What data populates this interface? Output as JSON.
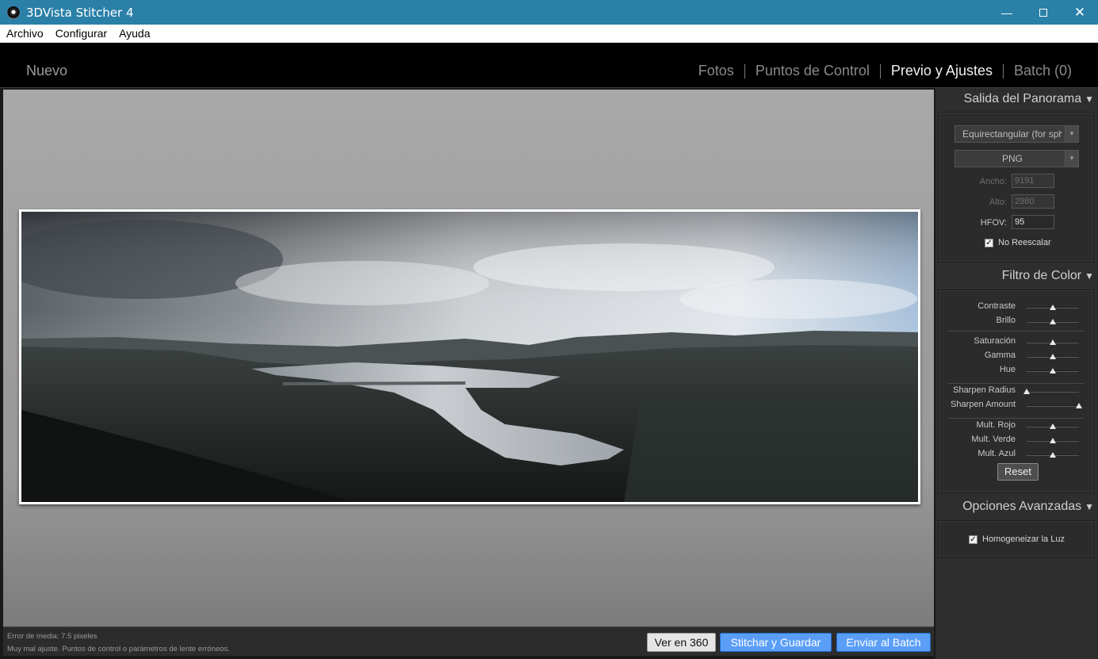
{
  "window": {
    "title": "3DVista Stitcher 4"
  },
  "menu": [
    "Archivo",
    "Configurar",
    "Ayuda"
  ],
  "nav": {
    "new_label": "Nuevo",
    "tabs": [
      "Fotos",
      "Puntos de Control",
      "Previo y Ajustes",
      "Batch (0)"
    ],
    "active_tab": "Previo y Ajustes"
  },
  "status": {
    "line1": "Error de media: 7.5 pixeles",
    "line2": "Muy mal ajuste. Puntos de control o parámetros de lente erróneos."
  },
  "buttons": {
    "view360": "Ver en 360",
    "stitch": "Stitchar y Guardar",
    "batch": "Enviar al Batch"
  },
  "sidebar": {
    "output": {
      "title": "Salida del Panorama",
      "projection": "Equirectangular (for spherical)",
      "format": "PNG",
      "width_label": "Ancho:",
      "width": "9191",
      "height_label": "Alto:",
      "height": "2980",
      "hfov_label": "HFOV:",
      "hfov": "95",
      "no_rescale_label": "No Reescalar",
      "no_rescale_checked": true
    },
    "color": {
      "title": "Filtro de Color",
      "sliders": [
        {
          "label": "Contraste",
          "value": 0.5
        },
        {
          "label": "Brillo",
          "value": 0.5
        },
        {
          "label": "Saturación",
          "value": 0.5
        },
        {
          "label": "Gamma",
          "value": 0.5
        },
        {
          "label": "Hue",
          "value": 0.5
        },
        {
          "label": "Sharpen Radius",
          "value": 0.0
        },
        {
          "label": "Sharpen Amount",
          "value": 1.0
        },
        {
          "label": "Mult. Rojo",
          "value": 0.5
        },
        {
          "label": "Mult. Verde",
          "value": 0.5
        },
        {
          "label": "Mult. Azul",
          "value": 0.5
        }
      ],
      "reset_label": "Reset"
    },
    "advanced": {
      "title": "Opciones Avanzadas",
      "homogenize_label": "Homogeneizar la Luz",
      "homogenize_checked": true
    }
  },
  "colors": {
    "titlebar": "#2b80a8",
    "accent_button": "#5b9ef7"
  }
}
